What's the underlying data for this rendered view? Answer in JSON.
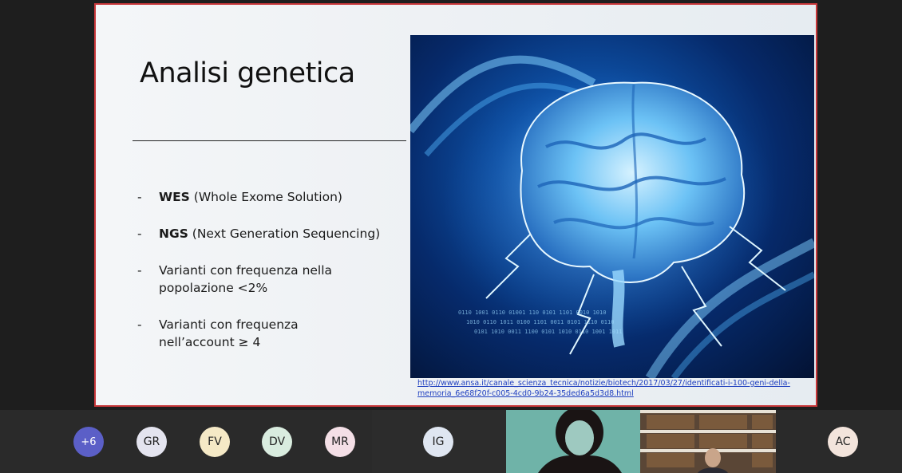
{
  "slide": {
    "title": "Analisi genetica",
    "bullets": [
      {
        "dash": "-",
        "bold": "WES",
        "rest": " (Whole Exome Solution)"
      },
      {
        "dash": "-",
        "bold": "NGS",
        "rest": " (Next Generation Sequencing)"
      },
      {
        "dash": "-",
        "bold": "",
        "rest": "Varianti con frequenza nella popolazione <2%"
      },
      {
        "dash": "-",
        "bold": "",
        "rest": "Varianti con frequenza nell’account ≥ 4"
      }
    ],
    "image_alt": "brain-dna-illustration",
    "source_link": "http://www.ansa.it/canale_scienza_tecnica/notizie/biotech/2017/03/27/identificati-i-100-geni-della-memoria_6e68f20f-c005-4cd0-9b24-35ded6a5d3d8.html"
  },
  "participants": {
    "overflow_count": "+6",
    "avatars": [
      {
        "initials": "GR",
        "color": "#e4e4ef"
      },
      {
        "initials": "FV",
        "color": "#f5e9c6"
      },
      {
        "initials": "DV",
        "color": "#d9ecdf"
      },
      {
        "initials": "MR",
        "color": "#f4dfe6"
      },
      {
        "initials": "IG",
        "color": "#dfe6f1"
      },
      {
        "initials": "AC",
        "color": "#f3e4dc"
      }
    ],
    "overflow_color": "#5b5fc7"
  }
}
